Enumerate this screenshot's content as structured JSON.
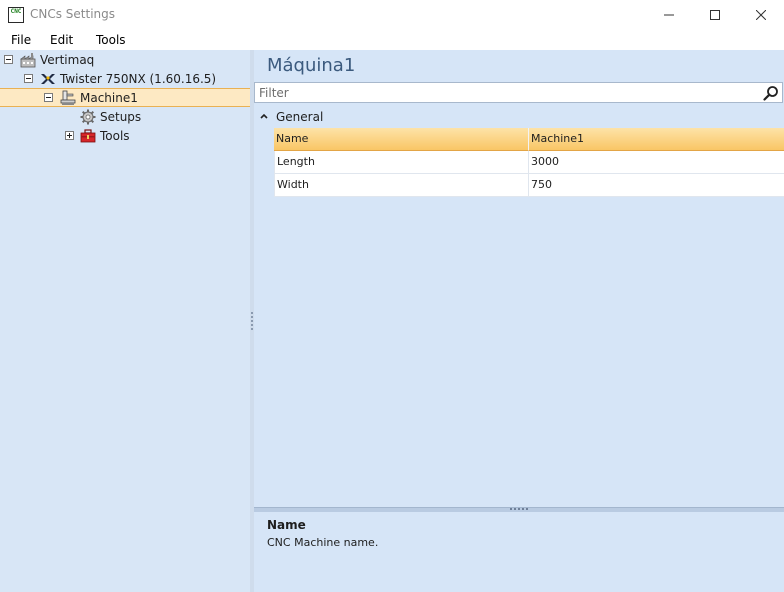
{
  "window": {
    "title": "CNCs Settings",
    "icon_text": "CNC",
    "buttons": {
      "minimize": "minimize",
      "maximize": "maximize",
      "close": "close"
    }
  },
  "menu": {
    "file": "File",
    "edit": "Edit",
    "tools": "Tools"
  },
  "tree": {
    "items": [
      {
        "label": "Vertimaq",
        "icon": "factory-icon",
        "expanded": true
      },
      {
        "label": "Twister 750NX (1.60.16.5)",
        "icon": "cnc-brand-icon",
        "expanded": true
      },
      {
        "label": "Machine1",
        "icon": "machine-icon",
        "expanded": true,
        "selected": true
      },
      {
        "label": "Setups",
        "icon": "gear-icon"
      },
      {
        "label": "Tools",
        "icon": "toolbox-icon",
        "expanded": false
      }
    ]
  },
  "main": {
    "title": "Máquina1",
    "filter_placeholder": "Filter",
    "category": "General",
    "grid": {
      "header": {
        "name": "Name",
        "value": "Machine1"
      },
      "rows": [
        {
          "name": "Length",
          "value": "3000"
        },
        {
          "name": "Width",
          "value": "750"
        }
      ]
    },
    "help": {
      "title": "Name",
      "description": "CNC Machine name."
    }
  },
  "colors": {
    "selection_bg": "#fde9c3",
    "selection_border": "#e9b153",
    "panel_bg": "#d6e5f7",
    "title_color": "#3b5a7e",
    "grid_header": "#f9c665"
  }
}
